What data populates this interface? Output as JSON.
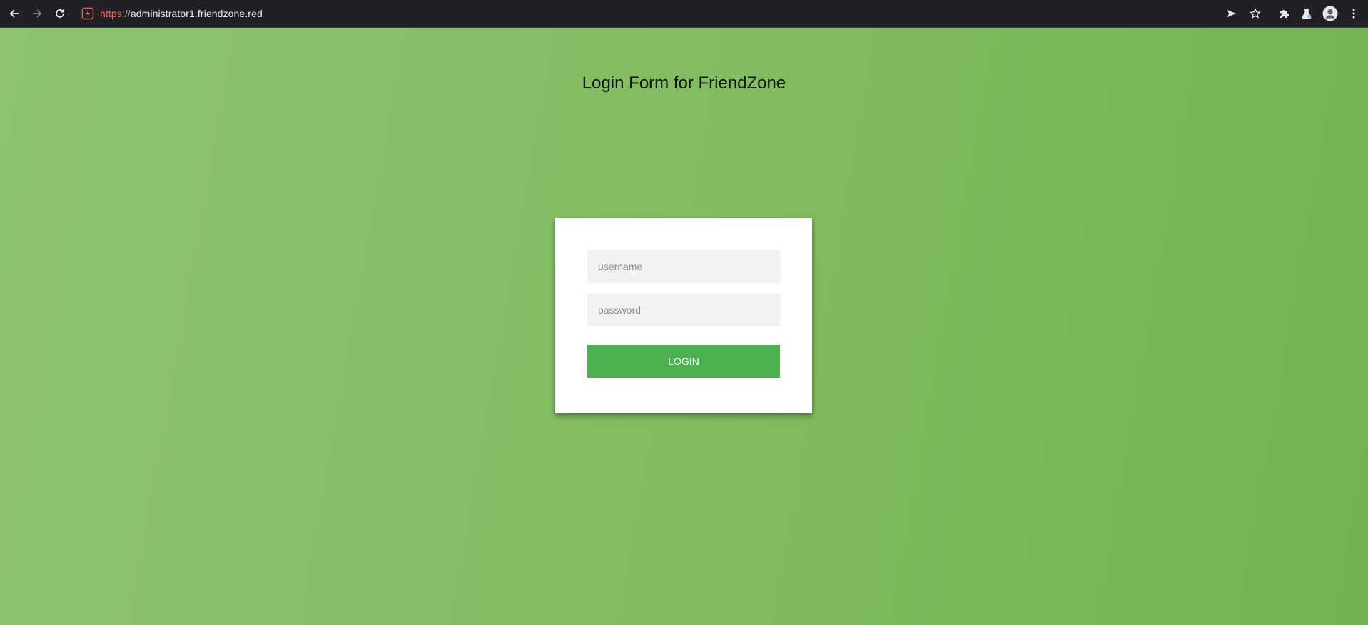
{
  "browser": {
    "url_scheme": "https",
    "url_separator": "://",
    "url_host": "administrator1.friendzone.red"
  },
  "page": {
    "title": "Login Form for FriendZone"
  },
  "form": {
    "username_placeholder": "username",
    "password_placeholder": "password",
    "login_label": "LOGIN"
  },
  "colors": {
    "toolbar": "#202124",
    "background_start": "#8dc36f",
    "background_end": "#72b34f",
    "button": "#4caf50",
    "insecure": "#ee675c"
  },
  "icons": {
    "back": "back-arrow-icon",
    "forward": "forward-arrow-icon",
    "reload": "reload-icon",
    "security": "not-secure-icon",
    "send": "send-icon",
    "bookmark": "star-icon",
    "extensions": "puzzle-icon",
    "labs": "flask-icon",
    "profile": "avatar-icon",
    "menu": "kebab-menu-icon"
  }
}
